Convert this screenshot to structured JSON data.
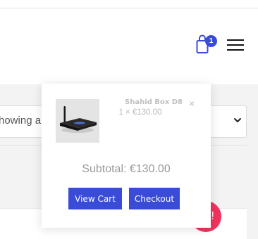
{
  "header": {
    "cart_icon": "shopping-bag-icon",
    "cart_count": "1",
    "menu_icon": "hamburger-menu-icon"
  },
  "sort": {
    "label": "howing a",
    "chevron_icon": "chevron-down-icon"
  },
  "fab": {
    "label": "e!"
  },
  "mini_cart": {
    "item": {
      "name": "Shahid Box D8",
      "qty_price": "1 × €130.00",
      "remove_symbol": "×"
    },
    "subtotal": "Subtotal: €130.00",
    "view_cart_label": "View Cart",
    "checkout_label": "Checkout"
  },
  "colors": {
    "accent": "#3a4bd8",
    "fab": "#f2335f"
  }
}
